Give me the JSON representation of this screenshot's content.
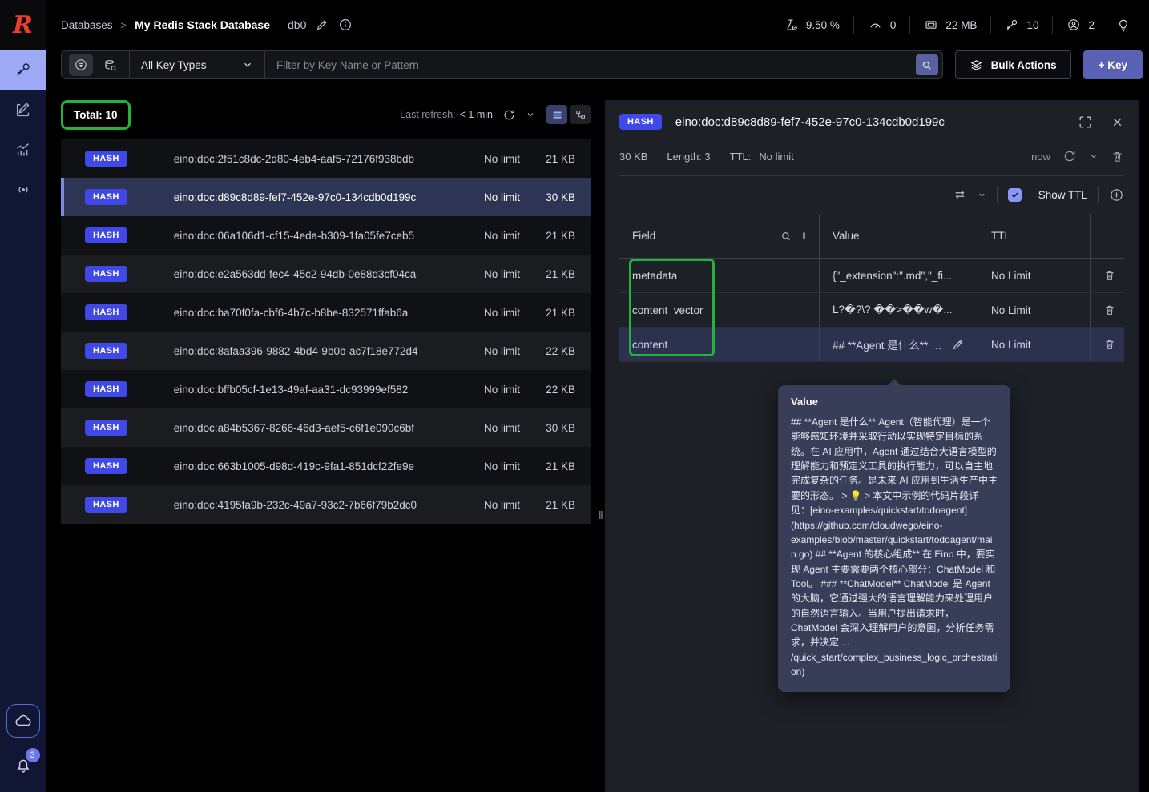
{
  "colors": {
    "redis_red": "#ee3b2f",
    "accent_blue": "#5961b5",
    "hash_badge_blue": "#4049e8",
    "highlight_green": "#24b23d",
    "selected_row": "#2e3554",
    "panel_bg": "#1d2027",
    "sidebar_active": "#9ea9f6"
  },
  "sidebar": {
    "nav": [
      {
        "name": "browser",
        "icon": "key-icon",
        "active": true
      },
      {
        "name": "workbench",
        "icon": "edit-square-icon",
        "active": false
      },
      {
        "name": "analytics",
        "icon": "analytics-chart-icon",
        "active": false
      },
      {
        "name": "pubsub",
        "icon": "broadcast-icon",
        "active": false
      }
    ],
    "cloud_icon": "cloud-icon",
    "notifications_icon": "bell-icon",
    "notifications_badge": "3"
  },
  "header": {
    "breadcrumb": {
      "root": "Databases",
      "separator": ">",
      "current": "My Redis Stack Database"
    },
    "db_label": "db0",
    "edit_icon": "pencil-icon",
    "info_icon": "info-circle-icon",
    "stats": [
      {
        "icon": "cpu-usage-icon",
        "value": "9.50 %"
      },
      {
        "icon": "commands-gauge-icon",
        "value": "0"
      },
      {
        "icon": "memory-icon",
        "value": "22 MB"
      },
      {
        "icon": "total-keys-icon",
        "value": "10"
      },
      {
        "icon": "connected-clients-icon",
        "value": "2"
      }
    ],
    "insights_icon": "lightbulb-icon"
  },
  "toolbar": {
    "filter_icon": "filter-circle-icon",
    "scan_icon": "scan-keys-icon",
    "key_type_filter": "All Key Types",
    "search_placeholder": "Filter by Key Name or Pattern",
    "search_icon": "search-icon",
    "bulk_actions_label": "Bulk Actions",
    "bulk_actions_icon": "layers-icon",
    "add_key_label": "+ Key"
  },
  "key_list": {
    "total_label": "Total: 10",
    "last_refresh_label": "Last refresh:",
    "last_refresh_value": "< 1 min",
    "refresh_icon": "refresh-icon",
    "view_icons": {
      "list": "list-view-icon",
      "tree": "tree-view-icon"
    },
    "rows": [
      {
        "type": "HASH",
        "name": "eino:doc:2f51c8dc-2d80-4eb4-aaf5-72176f938bdb",
        "ttl": "No limit",
        "size": "21 KB",
        "selected": false
      },
      {
        "type": "HASH",
        "name": "eino:doc:d89c8d89-fef7-452e-97c0-134cdb0d199c",
        "ttl": "No limit",
        "size": "30 KB",
        "selected": true
      },
      {
        "type": "HASH",
        "name": "eino:doc:06a106d1-cf15-4eda-b309-1fa05fe7ceb5",
        "ttl": "No limit",
        "size": "21 KB",
        "selected": false
      },
      {
        "type": "HASH",
        "name": "eino:doc:e2a563dd-fec4-45c2-94db-0e88d3cf04ca",
        "ttl": "No limit",
        "size": "21 KB",
        "selected": false
      },
      {
        "type": "HASH",
        "name": "eino:doc:ba70f0fa-cbf6-4b7c-b8be-832571ffab6a",
        "ttl": "No limit",
        "size": "21 KB",
        "selected": false
      },
      {
        "type": "HASH",
        "name": "eino:doc:8afaa396-9882-4bd4-9b0b-ac7f18e772d4",
        "ttl": "No limit",
        "size": "22 KB",
        "selected": false
      },
      {
        "type": "HASH",
        "name": "eino:doc:bffb05cf-1e13-49af-aa31-dc93999ef582",
        "ttl": "No limit",
        "size": "22 KB",
        "selected": false
      },
      {
        "type": "HASH",
        "name": "eino:doc:a84b5367-8266-46d3-aef5-c6f1e090c6bf",
        "ttl": "No limit",
        "size": "30 KB",
        "selected": false
      },
      {
        "type": "HASH",
        "name": "eino:doc:663b1005-d98d-419c-9fa1-851dcf22fe9e",
        "ttl": "No limit",
        "size": "21 KB",
        "selected": false
      },
      {
        "type": "HASH",
        "name": "eino:doc:4195fa9b-232c-49a7-93c2-7b66f79b2dc0",
        "ttl": "No limit",
        "size": "21 KB",
        "selected": false
      }
    ]
  },
  "details": {
    "type_badge": "HASH",
    "key_name": "eino:doc:d89c8d89-fef7-452e-97c0-134cdb0d199c",
    "expand_icon": "expand-icon",
    "close_icon": "close-icon",
    "size": "30 KB",
    "length_label": "Length: 3",
    "ttl_label": "TTL:",
    "ttl_value": "No limit",
    "refreshed": "now",
    "format_icon": "swap-format-icon",
    "show_ttl_label": "Show TTL",
    "add_field_icon": "plus-circle-icon",
    "table": {
      "headers": [
        "Field",
        "Value",
        "TTL"
      ],
      "rows": [
        {
          "field": "metadata",
          "value": "{\"_extension\":\".md\",\"_fi...",
          "ttl": "No Limit",
          "highlighted": false
        },
        {
          "field": "content_vector",
          "value": "L?�?\\? ��>��w�...",
          "ttl": "No Limit",
          "highlighted": false
        },
        {
          "field": "content",
          "value": "## **Agent 是什么** A...",
          "ttl": "No Limit",
          "highlighted": true
        }
      ]
    },
    "tooltip": {
      "title": "Value",
      "text": "## **Agent 是什么** Agent（智能代理）是一个能够感知环境并采取行动以实现特定目标的系统。在 AI 应用中，Agent 通过结合大语言模型的理解能力和预定义工具的执行能力，可以自主地完成复杂的任务。是未来 AI 应用到生活生产中主要的形态。 > 💡 > 本文中示例的代码片段详见：[eino-examples/quickstart/todoagent](https://github.com/cloudwego/eino-examples/blob/master/quickstart/todoagent/main.go) ## **Agent 的核心组成** 在 Eino 中，要实现 Agent 主要需要两个核心部分：ChatModel 和 Tool。 ### **ChatModel** ChatModel 是 Agent 的大脑，它通过强大的语言理解能力来处理用户的自然语言输入。当用户提出请求时，ChatModel 会深入理解用户的意图，分析任务需求，并决定 ... /quick_start/complex_business_logic_orchestration)"
    }
  }
}
